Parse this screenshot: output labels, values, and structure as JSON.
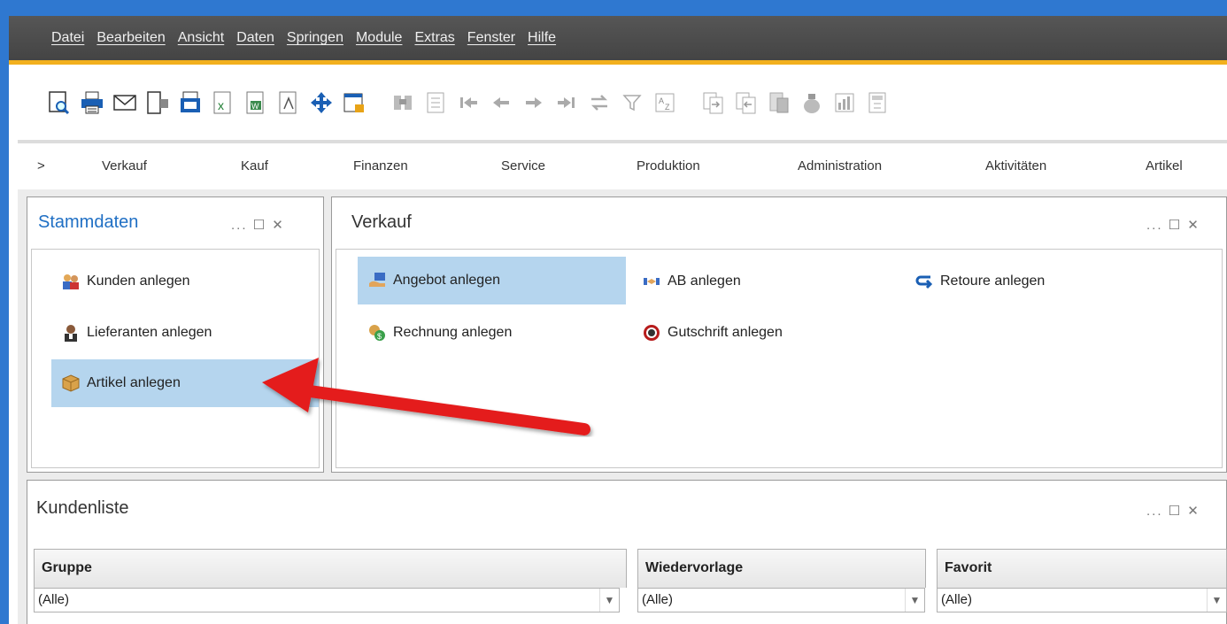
{
  "menubar": {
    "items": [
      "Datei",
      "Bearbeiten",
      "Ansicht",
      "Daten",
      "Springen",
      "Module",
      "Extras",
      "Fenster",
      "Hilfe"
    ]
  },
  "toolbar": {
    "icons": [
      "preview-icon",
      "print-icon",
      "email-icon",
      "export-device-icon",
      "fax-icon",
      "excel-icon",
      "word-icon",
      "pdf-icon",
      "move-icon",
      "lock-window-icon",
      "find-icon",
      "list-icon",
      "first-record-icon",
      "previous-record-icon",
      "next-record-icon",
      "last-record-icon",
      "refresh-icon",
      "filter-icon",
      "sort-icon",
      "copy-to-icon",
      "copy-from-icon",
      "document-icon",
      "money-bag-icon",
      "chart-icon",
      "calculator-icon"
    ]
  },
  "modnav": {
    "chevron": ">",
    "items": [
      "Verkauf",
      "Kauf",
      "Finanzen",
      "Service",
      "Produktion",
      "Administration",
      "Aktivitäten",
      "Artikel"
    ]
  },
  "stammdaten": {
    "title": "Stammdaten",
    "controls": "... ☐ ✕",
    "items": [
      {
        "label": "Kunden anlegen",
        "icon": "customers-icon"
      },
      {
        "label": "Lieferanten anlegen",
        "icon": "supplier-icon"
      },
      {
        "label": "Artikel anlegen",
        "icon": "package-icon",
        "selected": true
      }
    ]
  },
  "verkauf": {
    "title": "Verkauf",
    "controls": "... ☐ ✕",
    "items": [
      {
        "label": "Angebot anlegen",
        "icon": "offer-icon",
        "selected": true
      },
      {
        "label": "AB anlegen",
        "icon": "order-confirmation-icon"
      },
      {
        "label": "Retoure anlegen",
        "icon": "return-icon"
      },
      {
        "label": "Rechnung anlegen",
        "icon": "invoice-icon"
      },
      {
        "label": "Gutschrift anlegen",
        "icon": "credit-note-icon"
      }
    ]
  },
  "kundenliste": {
    "title": "Kundenliste",
    "controls": "... ☐ ✕",
    "filters": [
      {
        "header": "Gruppe",
        "value": "(Alle)"
      },
      {
        "header": "Wiedervorlage",
        "value": "(Alle)"
      },
      {
        "header": "Favorit",
        "value": "(Alle)"
      }
    ]
  },
  "colors": {
    "frame": "#2f78d0",
    "accent": "#f2b01e",
    "selection": "#b5d5ee",
    "title_blue": "#1f6fc4",
    "arrow": "#e41b1b"
  }
}
